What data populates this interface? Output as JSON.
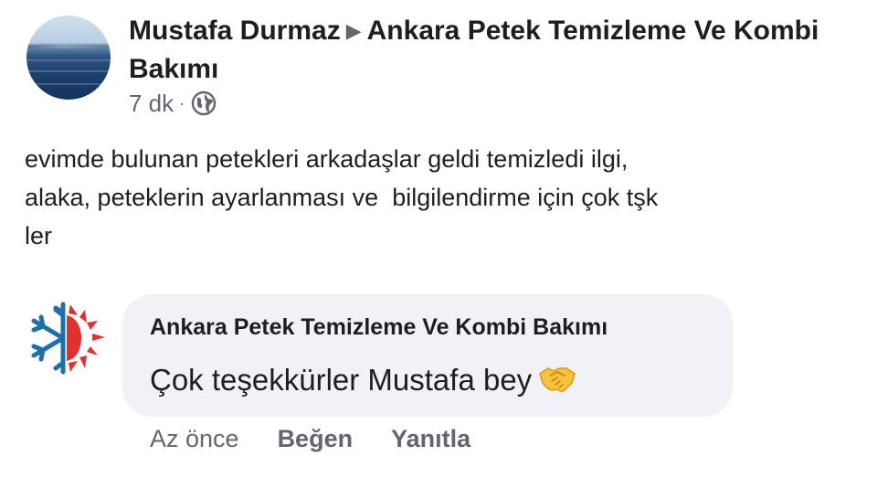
{
  "post": {
    "author": "Mustafa Durmaz",
    "target_page": "Ankara Petek Temizleme Ve Kombi Bakımı",
    "time": "7 dk",
    "separator": "·",
    "audience_icon": "globe-icon",
    "text": "evimde bulunan petekleri arkadaşlar geldi temizledi ilgi,\nalaka, peteklerin ayarlanması ve  bilgilendirme için çok tşk\nler"
  },
  "comment": {
    "author": "Ankara Petek Temizleme Ve Kombi Bakımı",
    "text": "Çok teşekkürler Mustafa bey",
    "emoji_icon": "handshake-icon",
    "time": "Az önce",
    "like_label": "Beğen",
    "reply_label": "Yanıtla"
  },
  "colors": {
    "text_primary": "#1c1e21",
    "text_secondary": "#606770",
    "bubble_bg": "#f0f2f5",
    "logo_blue": "#1f6fa8",
    "logo_red": "#e0312f"
  }
}
